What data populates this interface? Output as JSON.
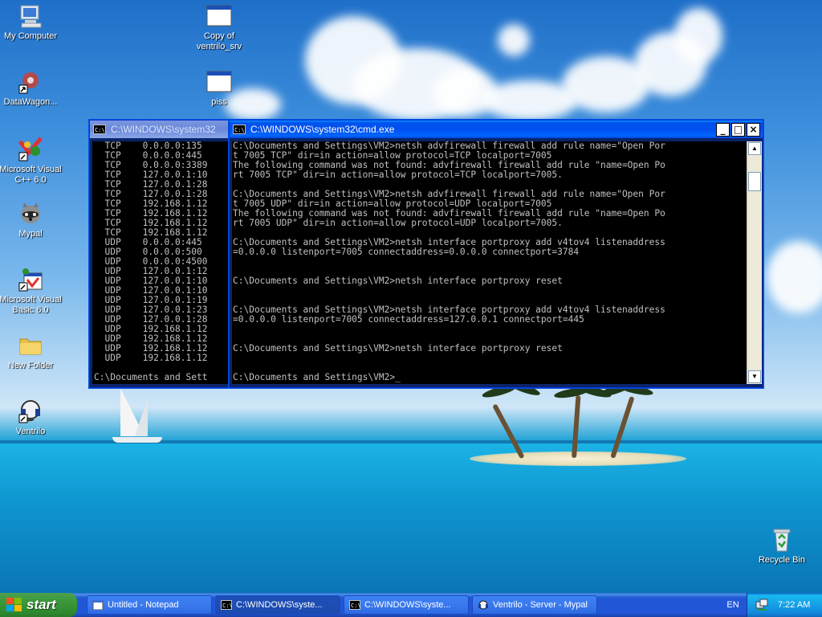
{
  "desktop": {
    "icons": [
      {
        "label": "My Computer"
      },
      {
        "label": "DataWagon..."
      },
      {
        "label": "Microsoft Visual C++ 6.0"
      },
      {
        "label": "Mypal"
      },
      {
        "label": "Microsoft Visual Basic 6.0"
      },
      {
        "label": "New Folder"
      },
      {
        "label": "Ventrilo"
      },
      {
        "label": "Copy of ventrilo_srv"
      },
      {
        "label": "piss"
      },
      {
        "label": "Recycle Bin"
      }
    ]
  },
  "back_window": {
    "title": "C:\\WINDOWS\\system32",
    "lines": [
      "  TCP    0.0.0.0:135",
      "  TCP    0.0.0.0:445",
      "  TCP    0.0.0.0:3389",
      "  TCP    127.0.0.1:10",
      "  TCP    127.0.0.1:28",
      "  TCP    127.0.0.1:28",
      "  TCP    192.168.1.12",
      "  TCP    192.168.1.12",
      "  TCP    192.168.1.12",
      "  TCP    192.168.1.12",
      "  UDP    0.0.0.0:445",
      "  UDP    0.0.0.0:500",
      "  UDP    0.0.0.0:4500",
      "  UDP    127.0.0.1:12",
      "  UDP    127.0.0.1:10",
      "  UDP    127.0.0.1:10",
      "  UDP    127.0.0.1:19",
      "  UDP    127.0.0.1:23",
      "  UDP    127.0.0.1:28",
      "  UDP    192.168.1.12",
      "  UDP    192.168.1.12",
      "  UDP    192.168.1.12",
      "  UDP    192.168.1.12",
      "",
      "C:\\Documents and Sett"
    ]
  },
  "front_window": {
    "title": "C:\\WINDOWS\\system32\\cmd.exe",
    "minimize": "_",
    "maximize": "□",
    "close": "×",
    "lines": [
      "C:\\Documents and Settings\\VM2>netsh advfirewall firewall add rule name=\"Open Por",
      "t 7005 TCP\" dir=in action=allow protocol=TCP localport=7005",
      "The following command was not found: advfirewall firewall add rule \"name=Open Po",
      "rt 7005 TCP\" dir=in action=allow protocol=TCP localport=7005.",
      "",
      "C:\\Documents and Settings\\VM2>netsh advfirewall firewall add rule name=\"Open Por",
      "t 7005 UDP\" dir=in action=allow protocol=UDP localport=7005",
      "The following command was not found: advfirewall firewall add rule \"name=Open Po",
      "rt 7005 UDP\" dir=in action=allow protocol=UDP localport=7005.",
      "",
      "C:\\Documents and Settings\\VM2>netsh interface portproxy add v4tov4 listenaddress",
      "=0.0.0.0 listenport=7005 connectaddress=0.0.0.0 connectport=3784",
      "",
      "",
      "C:\\Documents and Settings\\VM2>netsh interface portproxy reset",
      "",
      "",
      "C:\\Documents and Settings\\VM2>netsh interface portproxy add v4tov4 listenaddress",
      "=0.0.0.0 listenport=7005 connectaddress=127.0.0.1 connectport=445",
      "",
      "",
      "C:\\Documents and Settings\\VM2>netsh interface portproxy reset",
      "",
      "",
      "C:\\Documents and Settings\\VM2>_"
    ]
  },
  "taskbar": {
    "start_label": "start",
    "buttons": [
      {
        "label": "Untitled - Notepad"
      },
      {
        "label": "C:\\WINDOWS\\syste..."
      },
      {
        "label": "C:\\WINDOWS\\syste..."
      },
      {
        "label": "Ventrilo - Server - Mypal"
      }
    ],
    "language": "EN",
    "clock": "7:22 AM"
  },
  "colors": {
    "console_bg": "#000000",
    "console_fg": "#c0c0c0",
    "title_active": "#0050ee",
    "taskbar": "#2157d7",
    "start": "#3c9a3c"
  }
}
